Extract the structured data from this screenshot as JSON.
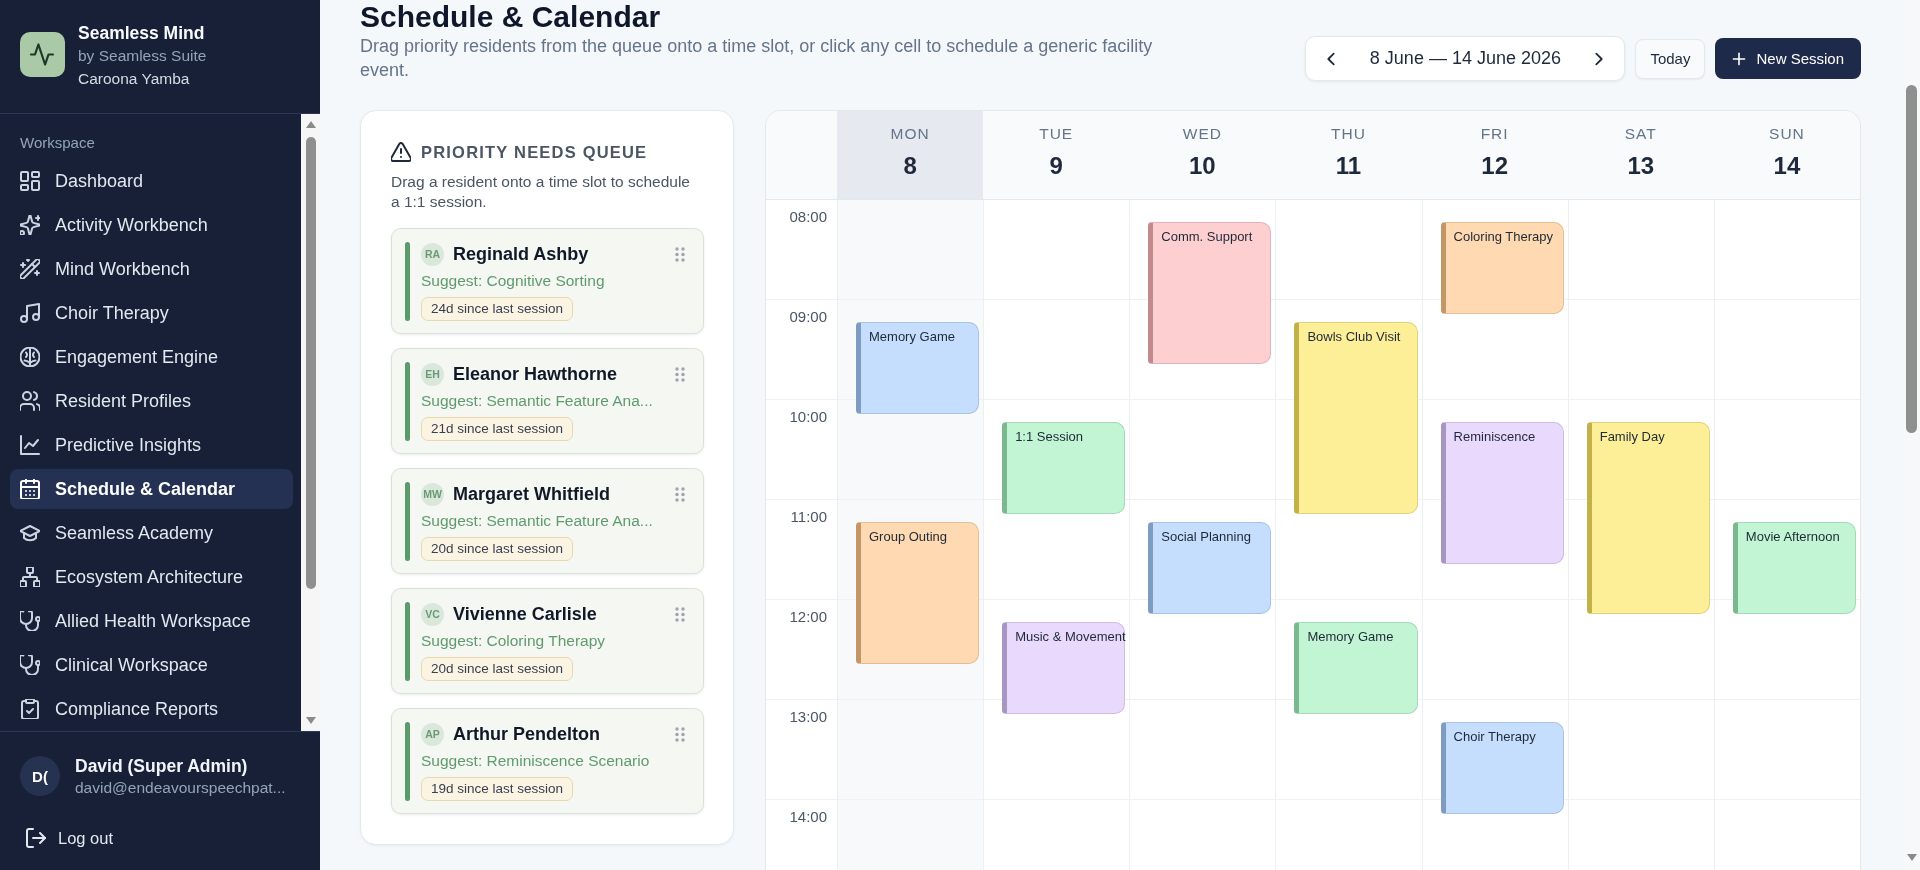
{
  "sidebar": {
    "brand": {
      "name": "Seamless Mind",
      "tagline": "by Seamless Suite",
      "organisation": "Caroona Yamba"
    },
    "section_label": "Workspace",
    "items": [
      {
        "label": "Dashboard",
        "selected": false
      },
      {
        "label": "Activity Workbench",
        "selected": false
      },
      {
        "label": "Mind Workbench",
        "selected": false
      },
      {
        "label": "Choir Therapy",
        "selected": false
      },
      {
        "label": "Engagement Engine",
        "selected": false
      },
      {
        "label": "Resident Profiles",
        "selected": false
      },
      {
        "label": "Predictive Insights",
        "selected": false
      },
      {
        "label": "Schedule & Calendar",
        "selected": true
      },
      {
        "label": "Seamless Academy",
        "selected": false
      },
      {
        "label": "Ecosystem Architecture",
        "selected": false
      },
      {
        "label": "Allied Health Workspace",
        "selected": false
      },
      {
        "label": "Clinical Workspace",
        "selected": false
      },
      {
        "label": "Compliance Reports",
        "selected": false
      }
    ],
    "user": {
      "initials": "D(",
      "name": "David (Super Admin)",
      "email": "david@endeavourspeechpat..."
    },
    "logout": "Log out"
  },
  "header": {
    "title": "Schedule & Calendar",
    "subtitle": "Drag priority residents from the queue onto a time slot, or click any cell to schedule a generic facility event.",
    "date_range": "8 June — 14 June 2026",
    "buttons": [
      {
        "label": "Today",
        "kind": "secondary"
      },
      {
        "label": "New Session",
        "kind": "primary"
      }
    ]
  },
  "queue": {
    "title": "PRIORITY NEEDS QUEUE",
    "description": "Drag a resident onto a time slot to schedule a 1:1 session.",
    "residents": [
      {
        "initials": "RA",
        "name": "Reginald Ashby",
        "suggestion": "Suggest: Cognitive Sorting",
        "since": "24d since last session"
      },
      {
        "initials": "EH",
        "name": "Eleanor Hawthorne",
        "suggestion": "Suggest: Semantic Feature Ana...",
        "since": "21d since last session"
      },
      {
        "initials": "MW",
        "name": "Margaret Whitfield",
        "suggestion": "Suggest: Semantic Feature Ana...",
        "since": "20d since last session"
      },
      {
        "initials": "VC",
        "name": "Vivienne Carlisle",
        "suggestion": "Suggest: Coloring Therapy",
        "since": "20d since last session"
      },
      {
        "initials": "AP",
        "name": "Arthur Pendelton",
        "suggestion": "Suggest: Reminiscence Scenario",
        "since": "19d since last session"
      }
    ]
  },
  "calendar": {
    "times": [
      "08:00",
      "09:00",
      "10:00",
      "11:00",
      "12:00",
      "13:00",
      "14:00"
    ],
    "days": [
      {
        "weekday": "MON",
        "date": "8",
        "today": true,
        "slots": [
          {
            "kind": "open"
          },
          {
            "kind": "booked",
            "event": {
              "kind": "short",
              "title": "Memory Game",
              "color": "#c5defd"
            }
          },
          {
            "kind": "open"
          },
          {
            "kind": "booked",
            "event": {
              "kind": "medium",
              "title": "Group Outing",
              "color": "#fed9b1"
            }
          },
          {
            "kind": "open"
          },
          {
            "kind": "open"
          },
          {
            "kind": "open"
          }
        ]
      },
      {
        "weekday": "TUE",
        "date": "9",
        "today": false,
        "slots": [
          {
            "kind": "open"
          },
          {
            "kind": "open"
          },
          {
            "kind": "booked",
            "event": {
              "kind": "short",
              "title": "1:1 Session",
              "color": "#c2f5d4"
            }
          },
          {
            "kind": "open"
          },
          {
            "kind": "booked",
            "event": {
              "kind": "short",
              "title": "Music & Movement",
              "color": "#e8d9fd"
            }
          },
          {
            "kind": "open"
          },
          {
            "kind": "open"
          }
        ]
      },
      {
        "weekday": "WED",
        "date": "10",
        "today": false,
        "slots": [
          {
            "kind": "booked",
            "event": {
              "kind": "medium",
              "title": "Comm. Support",
              "color": "#fdcfd0"
            }
          },
          {
            "kind": "open"
          },
          {
            "kind": "open"
          },
          {
            "kind": "booked",
            "event": {
              "kind": "short",
              "title": "Social Planning",
              "color": "#c5defd"
            }
          },
          {
            "kind": "open"
          },
          {
            "kind": "open"
          },
          {
            "kind": "open"
          }
        ]
      },
      {
        "weekday": "THU",
        "date": "11",
        "today": false,
        "slots": [
          {
            "kind": "open"
          },
          {
            "kind": "booked",
            "event": {
              "kind": "long",
              "title": "Bowls Club Visit",
              "color": "#fdee98"
            }
          },
          {
            "kind": "open"
          },
          {
            "kind": "open"
          },
          {
            "kind": "booked",
            "event": {
              "kind": "short",
              "title": "Memory Game",
              "color": "#c2f5d4"
            }
          },
          {
            "kind": "open"
          },
          {
            "kind": "open"
          }
        ]
      },
      {
        "weekday": "FRI",
        "date": "12",
        "today": false,
        "slots": [
          {
            "kind": "booked",
            "event": {
              "kind": "short",
              "title": "Coloring Therapy",
              "color": "#fed9b1"
            }
          },
          {
            "kind": "open"
          },
          {
            "kind": "booked",
            "event": {
              "kind": "medium",
              "title": "Reminiscence",
              "color": "#e8d9fd"
            }
          },
          {
            "kind": "open"
          },
          {
            "kind": "open"
          },
          {
            "kind": "booked",
            "event": {
              "kind": "short",
              "title": "Choir Therapy",
              "color": "#c5defd"
            }
          },
          {
            "kind": "open"
          }
        ]
      },
      {
        "weekday": "SAT",
        "date": "13",
        "today": false,
        "slots": [
          {
            "kind": "open"
          },
          {
            "kind": "open"
          },
          {
            "kind": "booked",
            "event": {
              "kind": "long",
              "title": "Family Day",
              "color": "#fdee98"
            }
          },
          {
            "kind": "open"
          },
          {
            "kind": "open"
          },
          {
            "kind": "open"
          },
          {
            "kind": "open"
          }
        ]
      },
      {
        "weekday": "SUN",
        "date": "14",
        "today": false,
        "slots": [
          {
            "kind": "open"
          },
          {
            "kind": "open"
          },
          {
            "kind": "open"
          },
          {
            "kind": "booked",
            "event": {
              "kind": "short",
              "title": "Movie Afternoon",
              "color": "#c2f5d4"
            }
          },
          {
            "kind": "open"
          },
          {
            "kind": "open"
          },
          {
            "kind": "open"
          }
        ]
      }
    ]
  }
}
